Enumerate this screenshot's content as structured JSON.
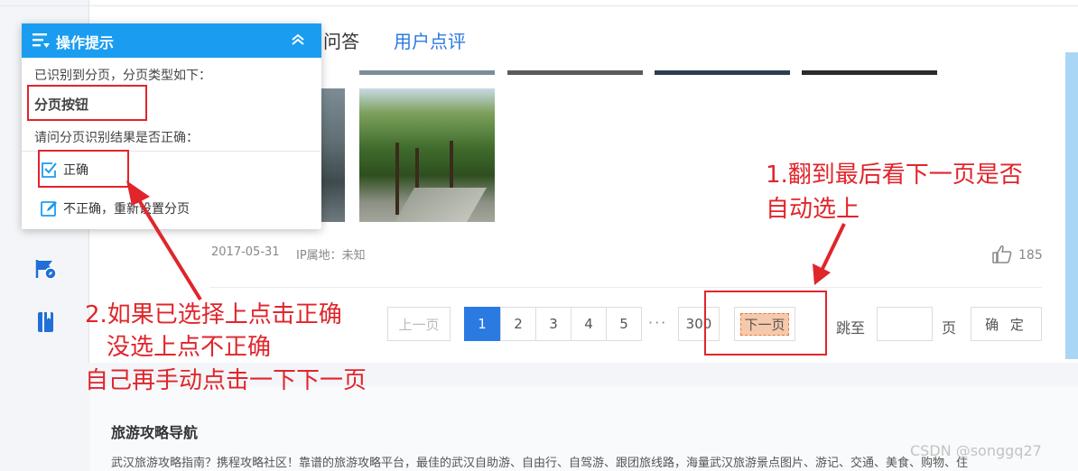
{
  "tabs": {
    "qa": "问答",
    "reviews": "用户点评"
  },
  "review": {
    "date": "2017-05-31",
    "ip_location": "IP属地：未知",
    "like_count": "185"
  },
  "pagination": {
    "prev_label": "上一页",
    "pages": [
      "1",
      "2",
      "3",
      "4",
      "5"
    ],
    "current_page": "1",
    "ellipsis": "···",
    "last_page": "300",
    "next_label": "下一页",
    "goto_label": "跳至",
    "goto_value": "",
    "goto_unit": "页",
    "confirm_label": "确 定"
  },
  "footer": {
    "title": "旅游攻略导航",
    "text": "武汉旅游攻略指南？携程攻略社区！靠谱的旅游攻略平台，最佳的武汉自助游、自由行、自驾游、跟团旅线路，海量武汉旅游景点图片、游记、交通、美食、购物、住"
  },
  "popup": {
    "title": "操作提示",
    "detected_line": "已识别到分页，分页类型如下：",
    "pagination_type": "分页按钮",
    "question": "请问分页识别结果是否正确：",
    "option_correct": "正确",
    "option_incorrect": "不正确，重新设置分页"
  },
  "annotations": {
    "note1_line1": "1.翻到最后看下一页是否",
    "note1_line2": "自动选上",
    "note2_line1": "2.如果已选择上点击正确",
    "note2_line2": "没选上点不正确",
    "note2_line3": "自己再手动点击一下下一页",
    "color": "#e0252b"
  },
  "watermark": "CSDN @songgq27",
  "colors": {
    "accent": "#2a7ae2",
    "popup_header": "#1a9df0",
    "annotation_red": "#e0252b"
  },
  "icons": [
    "menu-list-icon",
    "chevron-up-icon",
    "checkbox-checked-icon",
    "edit-icon",
    "map-flag-icon",
    "book-icon",
    "bus-icon",
    "photo-icon",
    "thumbs-up-icon"
  ]
}
